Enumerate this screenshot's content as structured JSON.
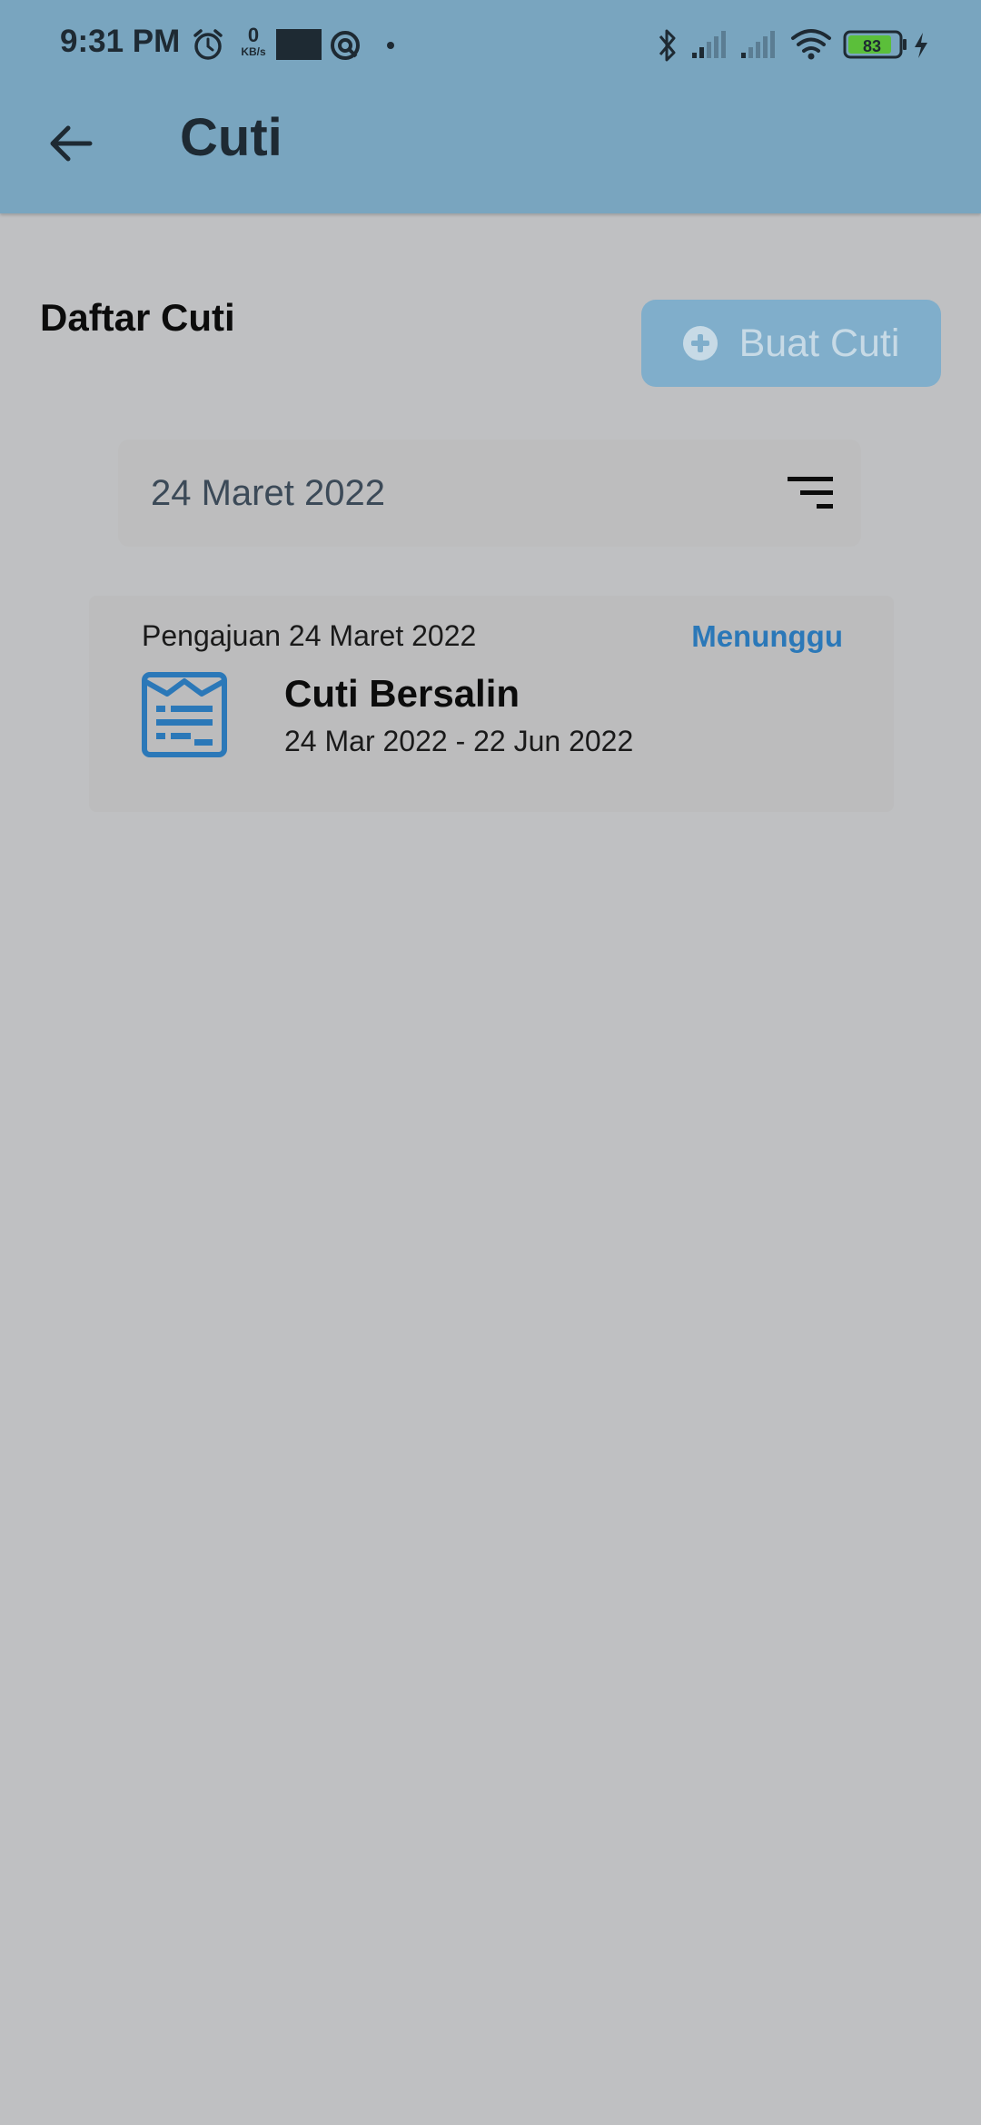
{
  "status_bar": {
    "time": "9:31 PM",
    "net_speed_value": "0",
    "net_speed_unit": "KB/s",
    "battery": "83",
    "icons": [
      "alarm-icon",
      "net-speed-icon",
      "notification-block",
      "record-icon",
      "dot",
      "bluetooth-icon",
      "signal-icon",
      "signal-icon-2",
      "wifi-icon",
      "battery-icon",
      "charging-icon"
    ]
  },
  "app_bar": {
    "title": "Cuti",
    "back_icon": "arrow-left-icon"
  },
  "header": {
    "title": "Daftar Cuti",
    "create_button_label": "Buat Cuti"
  },
  "filter": {
    "date": "24 Maret 2022",
    "icon": "filter-lines-icon"
  },
  "leave_requests": [
    {
      "submitted": "Pengajuan 24 Maret 2022",
      "status": "Menunggu",
      "type": "Cuti Bersalin",
      "range": "24 Mar 2022 - 22 Jun 2022"
    }
  ],
  "colors": {
    "app_bar": "#79a5bf",
    "background": "#bfc0c2",
    "accent": "#2b78b8",
    "button": "#80aecb"
  }
}
